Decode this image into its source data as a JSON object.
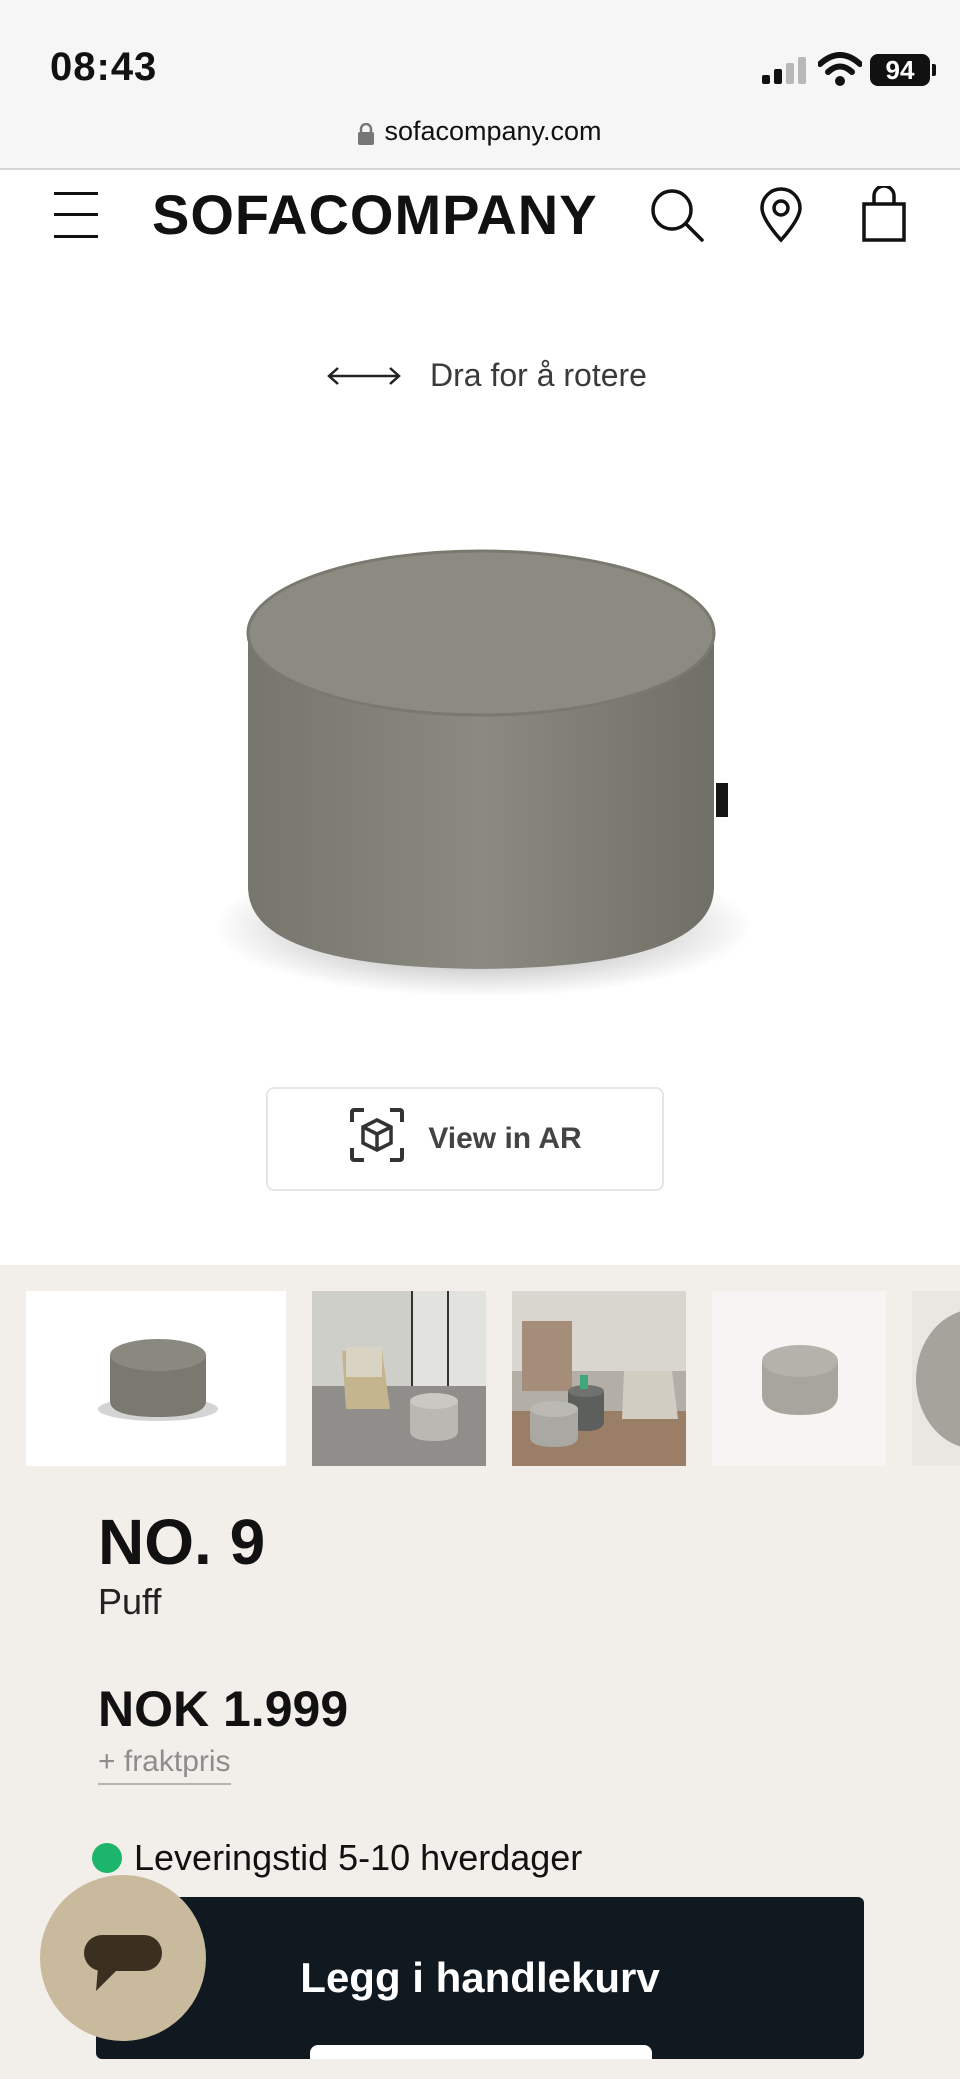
{
  "status_bar": {
    "time": "08:43",
    "battery": "94"
  },
  "browser": {
    "url": "sofacompany.com"
  },
  "header": {
    "logo": "SOFACOMPANY",
    "icons": [
      "menu-icon",
      "search-icon",
      "location-pin-icon",
      "shopping-bag-icon"
    ]
  },
  "viewer": {
    "rotate_hint": "Dra for å rotere",
    "ar_button_label": "View in AR"
  },
  "gallery": {
    "thumbnails": [
      "pouf-white-background",
      "pouf-living-room-chair",
      "pouf-room-table-sofa",
      "pouf-top-view",
      "pouf-closeup"
    ],
    "selected_index": 0
  },
  "product": {
    "name": "NO. 9",
    "type": "Puff",
    "price": "NOK 1.999",
    "shipping_note": "+ fraktpris",
    "delivery": "Leveringstid 5-10 hverdager"
  },
  "actions": {
    "add_to_cart": "Legg i handlekurv",
    "chat": "chat-icon"
  },
  "colors": {
    "accent_dark": "#101820",
    "panel_bg": "#f2efea",
    "status_green": "#1db56b",
    "chat_bubble": "#c9b99d"
  }
}
